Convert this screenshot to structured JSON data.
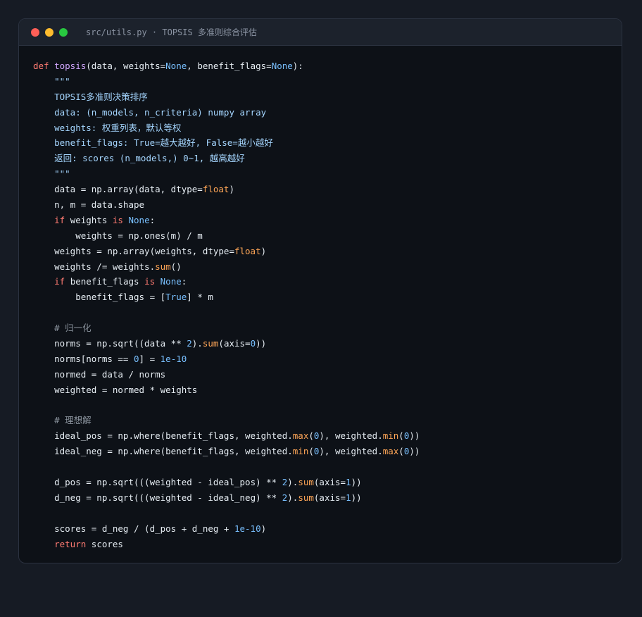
{
  "window": {
    "title": "src/utils.py · TOPSIS 多准则综合评估",
    "controls": [
      {
        "name": "close",
        "color": "#ff5f57"
      },
      {
        "name": "minimize",
        "color": "#febc2e"
      },
      {
        "name": "maximize",
        "color": "#28c840"
      }
    ]
  },
  "colors": {
    "keyword": "#ff7b72",
    "function": "#d2a8ff",
    "constant": "#79c0ff",
    "string": "#a5d6ff",
    "builtin": "#ffa657",
    "comment": "#8b949e",
    "text": "#e6edf3"
  },
  "code_lines": [
    [
      {
        "t": "def",
        "c": "kw"
      },
      {
        "t": " "
      },
      {
        "t": "topsis",
        "c": "fn"
      },
      {
        "t": "(data, weights="
      },
      {
        "t": "None",
        "c": "con"
      },
      {
        "t": ", benefit_flags="
      },
      {
        "t": "None",
        "c": "con"
      },
      {
        "t": "):"
      }
    ],
    [
      {
        "t": "    \"\"\"",
        "c": "str"
      }
    ],
    [
      {
        "t": "    TOPSIS多准则决策排序",
        "c": "str"
      }
    ],
    [
      {
        "t": "    data: (n_models, n_criteria) numpy array",
        "c": "str"
      }
    ],
    [
      {
        "t": "    weights: 权重列表，默认等权",
        "c": "str"
      }
    ],
    [
      {
        "t": "    benefit_flags: True=越大越好, False=越小越好",
        "c": "str"
      }
    ],
    [
      {
        "t": "    返回: scores (n_models,) 0~1, 越高越好",
        "c": "str"
      }
    ],
    [
      {
        "t": "    \"\"\"",
        "c": "str"
      }
    ],
    [
      {
        "t": "    data = np.array(data, dtype="
      },
      {
        "t": "float",
        "c": "bi"
      },
      {
        "t": ")"
      }
    ],
    [
      {
        "t": "    n, m = data.shape"
      }
    ],
    [
      {
        "t": "    "
      },
      {
        "t": "if",
        "c": "kw"
      },
      {
        "t": " weights "
      },
      {
        "t": "is",
        "c": "kw"
      },
      {
        "t": " "
      },
      {
        "t": "None",
        "c": "con"
      },
      {
        "t": ":"
      }
    ],
    [
      {
        "t": "        weights = np.ones(m) / m"
      }
    ],
    [
      {
        "t": "    weights = np.array(weights, dtype="
      },
      {
        "t": "float",
        "c": "bi"
      },
      {
        "t": ")"
      }
    ],
    [
      {
        "t": "    weights /= weights."
      },
      {
        "t": "sum",
        "c": "bi"
      },
      {
        "t": "()"
      }
    ],
    [
      {
        "t": "    "
      },
      {
        "t": "if",
        "c": "kw"
      },
      {
        "t": " benefit_flags "
      },
      {
        "t": "is",
        "c": "kw"
      },
      {
        "t": " "
      },
      {
        "t": "None",
        "c": "con"
      },
      {
        "t": ":"
      }
    ],
    [
      {
        "t": "        benefit_flags = ["
      },
      {
        "t": "True",
        "c": "con"
      },
      {
        "t": "] * m"
      }
    ],
    [],
    [
      {
        "t": "    # 归一化",
        "c": "cm"
      }
    ],
    [
      {
        "t": "    norms = np.sqrt((data ** "
      },
      {
        "t": "2",
        "c": "num"
      },
      {
        "t": ")."
      },
      {
        "t": "sum",
        "c": "bi"
      },
      {
        "t": "(axis="
      },
      {
        "t": "0",
        "c": "num"
      },
      {
        "t": "))"
      }
    ],
    [
      {
        "t": "    norms[norms == "
      },
      {
        "t": "0",
        "c": "num"
      },
      {
        "t": "] = "
      },
      {
        "t": "1e-10",
        "c": "num"
      }
    ],
    [
      {
        "t": "    normed = data / norms"
      }
    ],
    [
      {
        "t": "    weighted = normed * weights"
      }
    ],
    [],
    [
      {
        "t": "    # 理想解",
        "c": "cm"
      }
    ],
    [
      {
        "t": "    ideal_pos = np.where(benefit_flags, weighted."
      },
      {
        "t": "max",
        "c": "bi"
      },
      {
        "t": "("
      },
      {
        "t": "0",
        "c": "num"
      },
      {
        "t": "), weighted."
      },
      {
        "t": "min",
        "c": "bi"
      },
      {
        "t": "("
      },
      {
        "t": "0",
        "c": "num"
      },
      {
        "t": "))"
      }
    ],
    [
      {
        "t": "    ideal_neg = np.where(benefit_flags, weighted."
      },
      {
        "t": "min",
        "c": "bi"
      },
      {
        "t": "("
      },
      {
        "t": "0",
        "c": "num"
      },
      {
        "t": "), weighted."
      },
      {
        "t": "max",
        "c": "bi"
      },
      {
        "t": "("
      },
      {
        "t": "0",
        "c": "num"
      },
      {
        "t": "))"
      }
    ],
    [],
    [
      {
        "t": "    d_pos = np.sqrt((("
      },
      {
        "t": "weighted - ideal_pos) ** "
      },
      {
        "t": "2",
        "c": "num"
      },
      {
        "t": ")."
      },
      {
        "t": "sum",
        "c": "bi"
      },
      {
        "t": "(axis="
      },
      {
        "t": "1",
        "c": "num"
      },
      {
        "t": "))"
      }
    ],
    [
      {
        "t": "    d_neg = np.sqrt((("
      },
      {
        "t": "weighted - ideal_neg) ** "
      },
      {
        "t": "2",
        "c": "num"
      },
      {
        "t": ")."
      },
      {
        "t": "sum",
        "c": "bi"
      },
      {
        "t": "(axis="
      },
      {
        "t": "1",
        "c": "num"
      },
      {
        "t": "))"
      }
    ],
    [],
    [
      {
        "t": "    scores = d_neg / (d_pos + d_neg + "
      },
      {
        "t": "1e-10",
        "c": "num"
      },
      {
        "t": ")"
      }
    ],
    [
      {
        "t": "    "
      },
      {
        "t": "return",
        "c": "kw"
      },
      {
        "t": " scores"
      }
    ]
  ]
}
